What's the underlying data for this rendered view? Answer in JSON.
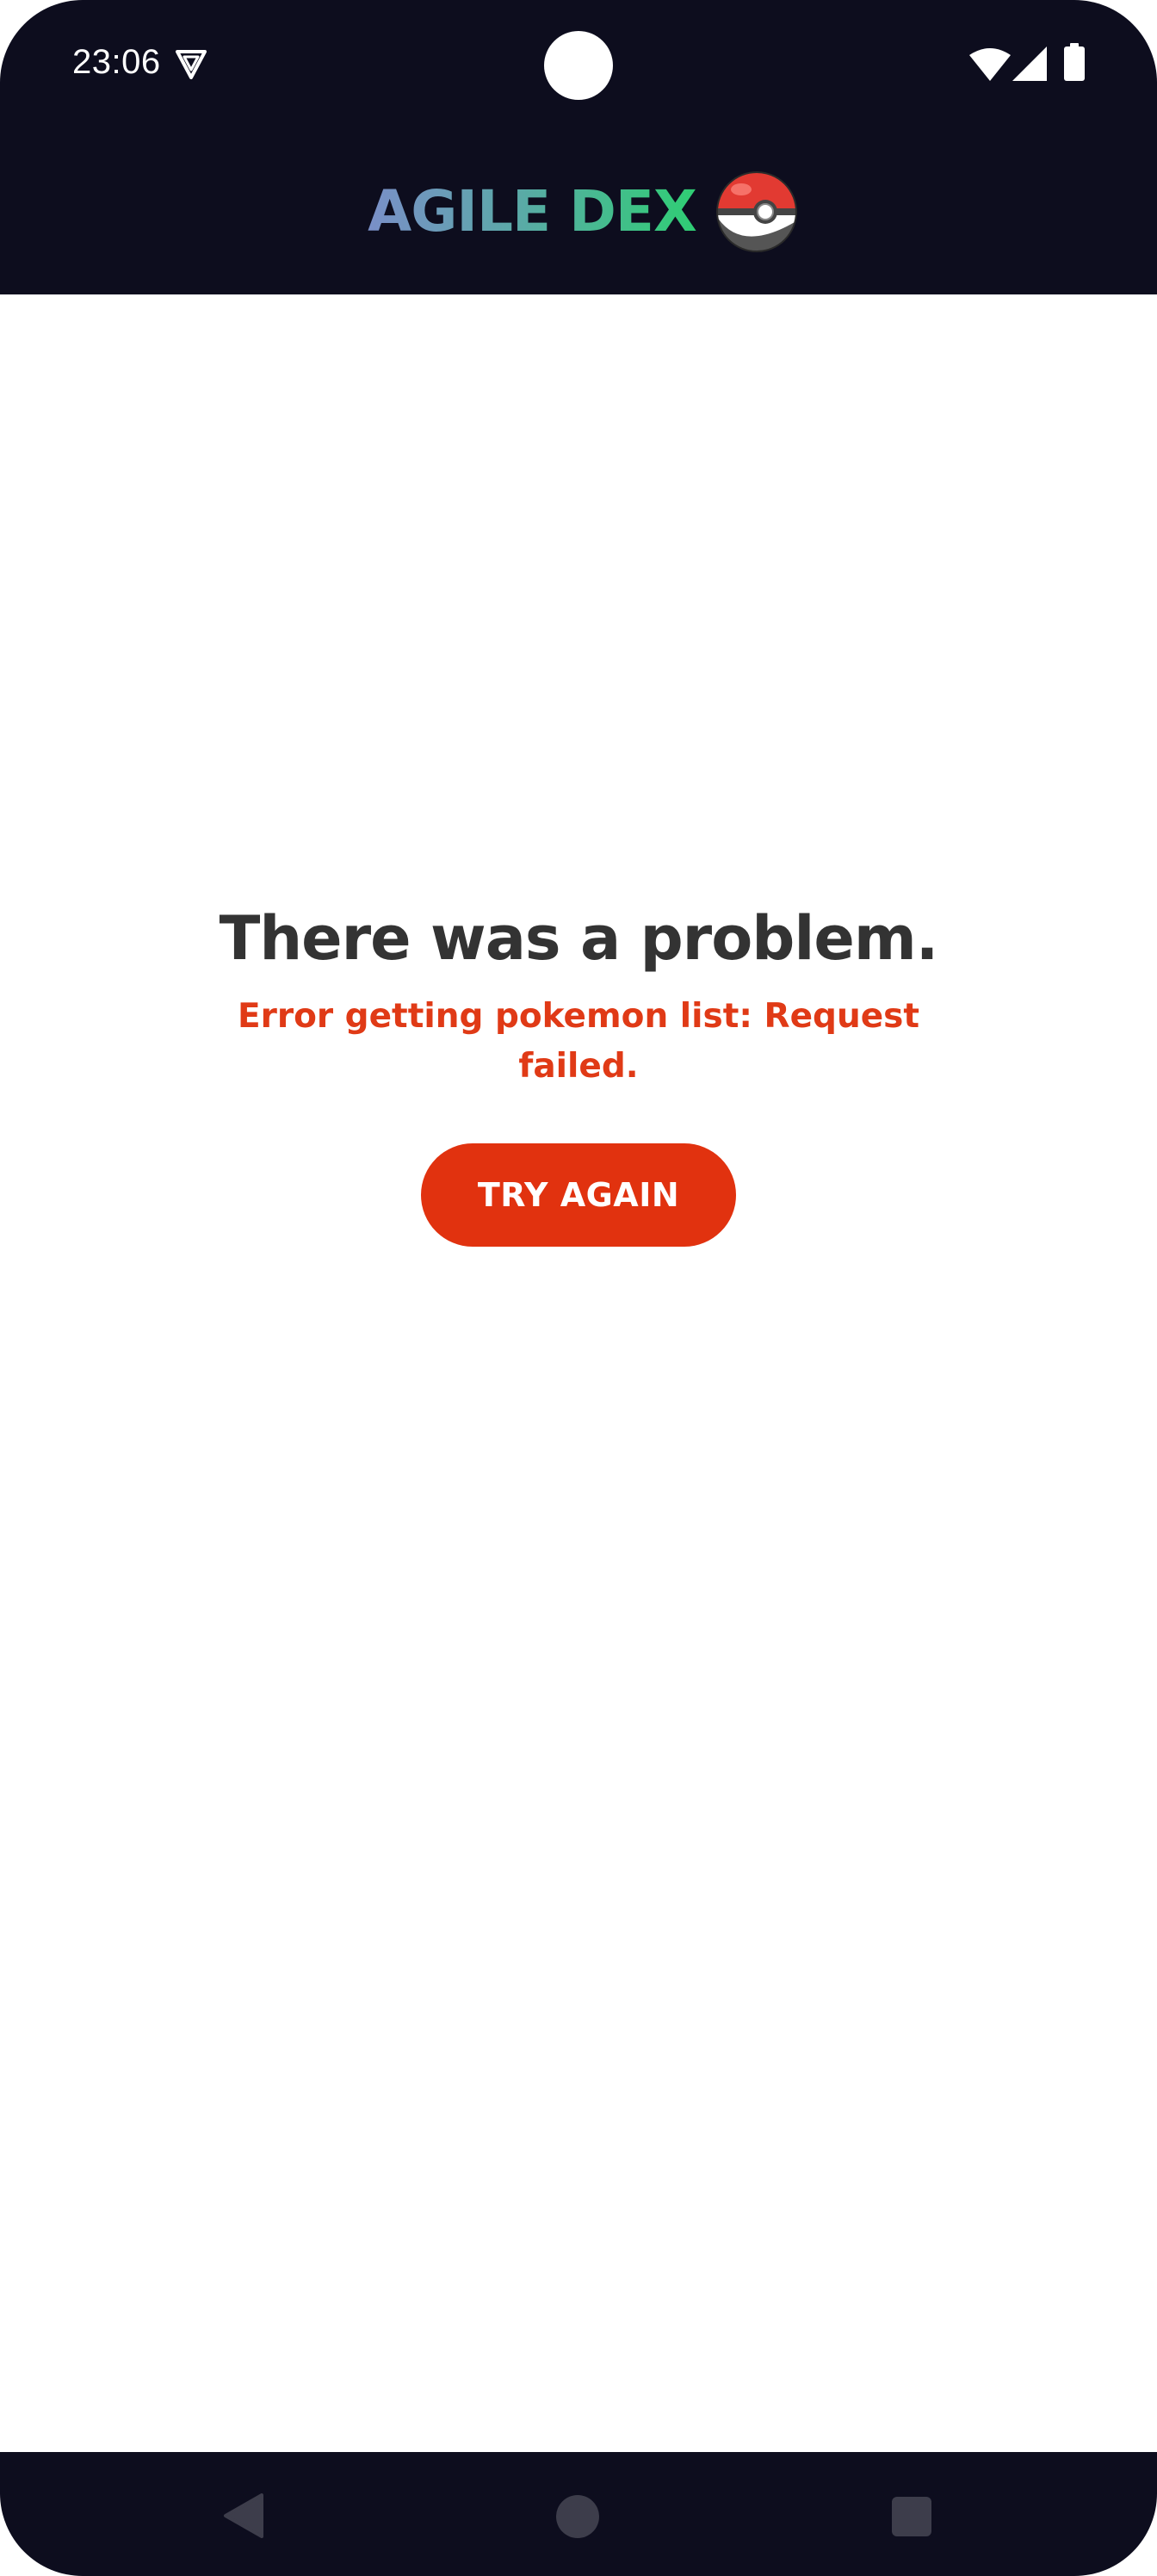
{
  "status_bar": {
    "time": "23:06",
    "icons": [
      "vpn-icon",
      "wifi-icon",
      "signal-icon",
      "battery-icon"
    ]
  },
  "app_bar": {
    "title": "AGILE DEX",
    "logo_icon": "pokeball-icon",
    "background_color": "#0d0d1e",
    "title_gradient": [
      "#7a8fc8",
      "#2fce74"
    ]
  },
  "error_view": {
    "title": "There was a problem.",
    "message": "Error getting pokemon list: Request failed.",
    "retry_button_label": "TRY AGAIN",
    "accent_color": "#e1320f"
  },
  "nav_bar": {
    "buttons": [
      "back-icon",
      "home-icon",
      "recents-icon"
    ]
  }
}
